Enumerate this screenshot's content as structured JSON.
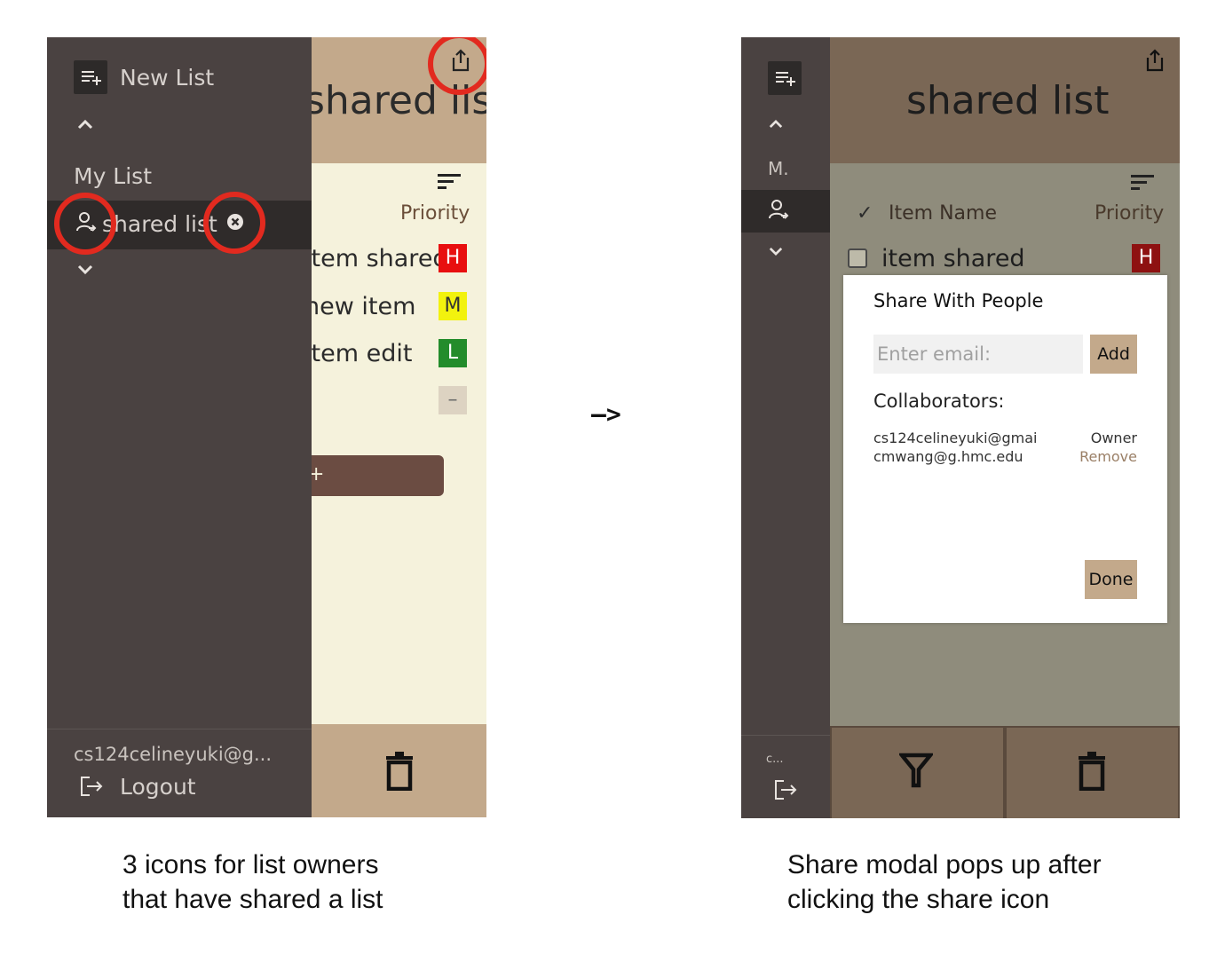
{
  "left": {
    "header_title": "shared list",
    "priority_header": "Priority",
    "rows": [
      {
        "text": "item shared",
        "priority": "H"
      },
      {
        "text": "new item",
        "priority": "M"
      },
      {
        "text": "item edit",
        "priority": "L"
      },
      {
        "text": "",
        "priority": "–"
      }
    ],
    "add_button_label": "+",
    "drawer": {
      "new_list_label": "New List",
      "section_title": "My List",
      "shared_item_label": "shared list",
      "user_email": "cs124celineyuki@g...",
      "logout_label": "Logout"
    }
  },
  "arrow": "–>",
  "right": {
    "header_title": "shared list",
    "column_headers": {
      "check": "✓",
      "item_name": "Item Name",
      "priority": "Priority"
    },
    "row": {
      "text": "item shared",
      "priority": "H"
    },
    "sidebar": {
      "section_abbrev": "M.",
      "shared_abbrev": ".",
      "email_abbrev": "c..."
    },
    "modal": {
      "title": "Share With People",
      "email_placeholder": "Enter email:",
      "add_label": "Add",
      "collaborators_title": "Collaborators:",
      "collaborators": [
        {
          "email": "cs124celineyuki@gmai",
          "role": "Owner"
        },
        {
          "email": "cmwang@g.hmc.edu",
          "role": "Remove"
        }
      ],
      "done_label": "Done"
    }
  },
  "captions": {
    "left": [
      "3 icons for list owners",
      "that have shared a list"
    ],
    "right": [
      "Share modal pops up after",
      "clicking the share icon"
    ]
  },
  "colors": {
    "highlight_ring": "#e22a1f",
    "priority_high": "#e80f0f",
    "priority_medium": "#f2f20e",
    "priority_low": "#238c2b",
    "header_tan": "#c3a98b",
    "drawer_bg": "#4a4241"
  }
}
